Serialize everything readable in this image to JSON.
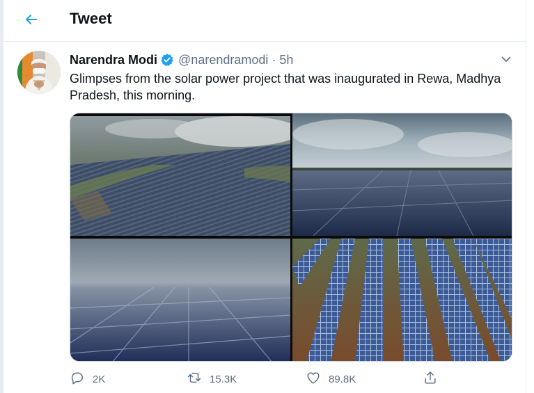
{
  "colors": {
    "accent": "#1da1f2",
    "text": "#0f1419",
    "muted": "#5b7083",
    "border": "#e6ecf0"
  },
  "header": {
    "title": "Tweet",
    "back_icon": "arrow-left-icon"
  },
  "tweet": {
    "author": {
      "display_name": "Narendra Modi",
      "verified": true,
      "handle": "@narendramodi"
    },
    "separator": "·",
    "timestamp": "5h",
    "text": "Glimpses from the solar power project that was inaugurated in Rewa, Madhya Pradesh, this morning.",
    "media": [
      {
        "subject": "aerial view of solar park fields"
      },
      {
        "subject": "solar panels under cloudy sky"
      },
      {
        "subject": "solar panel array in mist"
      },
      {
        "subject": "rows of solar panels on red soil"
      }
    ],
    "actions": {
      "reply": {
        "icon": "reply-icon",
        "count": "2K"
      },
      "retweet": {
        "icon": "retweet-icon",
        "count": "15.3K"
      },
      "like": {
        "icon": "heart-icon",
        "count": "89.8K"
      },
      "share": {
        "icon": "share-icon"
      }
    }
  }
}
